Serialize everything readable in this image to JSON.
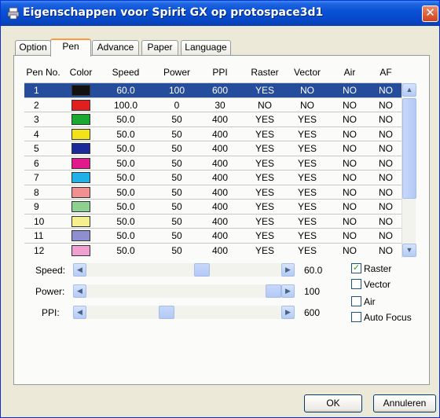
{
  "window": {
    "title": "Eigenschappen voor Spirit GX op protospace3d1",
    "close_glyph": "✕"
  },
  "tabs": [
    {
      "label": "Option",
      "active": false
    },
    {
      "label": "Pen",
      "active": true
    },
    {
      "label": "Advance",
      "active": false
    },
    {
      "label": "Paper",
      "active": false
    },
    {
      "label": "Language",
      "active": false
    }
  ],
  "table": {
    "headers": [
      "Pen No.",
      "Color",
      "Speed",
      "Power",
      "PPI",
      "Raster",
      "Vector",
      "Air",
      "AF"
    ],
    "rows": [
      {
        "pen": "1",
        "color": "#111111",
        "speed": "60.0",
        "power": "100",
        "ppi": "600",
        "raster": "YES",
        "vector": "NO",
        "air": "NO",
        "af": "NO",
        "selected": true
      },
      {
        "pen": "2",
        "color": "#e02020",
        "speed": "100.0",
        "power": "0",
        "ppi": "30",
        "raster": "NO",
        "vector": "NO",
        "air": "NO",
        "af": "NO",
        "selected": false
      },
      {
        "pen": "3",
        "color": "#1aa830",
        "speed": "50.0",
        "power": "50",
        "ppi": "400",
        "raster": "YES",
        "vector": "YES",
        "air": "NO",
        "af": "NO",
        "selected": false
      },
      {
        "pen": "4",
        "color": "#f2e21a",
        "speed": "50.0",
        "power": "50",
        "ppi": "400",
        "raster": "YES",
        "vector": "YES",
        "air": "NO",
        "af": "NO",
        "selected": false
      },
      {
        "pen": "5",
        "color": "#1a2a9a",
        "speed": "50.0",
        "power": "50",
        "ppi": "400",
        "raster": "YES",
        "vector": "YES",
        "air": "NO",
        "af": "NO",
        "selected": false
      },
      {
        "pen": "6",
        "color": "#e01a8a",
        "speed": "50.0",
        "power": "50",
        "ppi": "400",
        "raster": "YES",
        "vector": "YES",
        "air": "NO",
        "af": "NO",
        "selected": false
      },
      {
        "pen": "7",
        "color": "#22b0e8",
        "speed": "50.0",
        "power": "50",
        "ppi": "400",
        "raster": "YES",
        "vector": "YES",
        "air": "NO",
        "af": "NO",
        "selected": false
      },
      {
        "pen": "8",
        "color": "#f09090",
        "speed": "50.0",
        "power": "50",
        "ppi": "400",
        "raster": "YES",
        "vector": "YES",
        "air": "NO",
        "af": "NO",
        "selected": false
      },
      {
        "pen": "9",
        "color": "#8ed090",
        "speed": "50.0",
        "power": "50",
        "ppi": "400",
        "raster": "YES",
        "vector": "YES",
        "air": "NO",
        "af": "NO",
        "selected": false
      },
      {
        "pen": "10",
        "color": "#f5ef90",
        "speed": "50.0",
        "power": "50",
        "ppi": "400",
        "raster": "YES",
        "vector": "YES",
        "air": "NO",
        "af": "NO",
        "selected": false
      },
      {
        "pen": "11",
        "color": "#8e8ed0",
        "speed": "50.0",
        "power": "50",
        "ppi": "400",
        "raster": "YES",
        "vector": "YES",
        "air": "NO",
        "af": "NO",
        "selected": false
      },
      {
        "pen": "12",
        "color": "#f0a0d0",
        "speed": "50.0",
        "power": "50",
        "ppi": "400",
        "raster": "YES",
        "vector": "YES",
        "air": "NO",
        "af": "NO",
        "selected": false
      }
    ]
  },
  "scrollbar": {
    "up_glyph": "▲",
    "down_glyph": "▼",
    "left_glyph": "◀",
    "right_glyph": "▶"
  },
  "sliders": [
    {
      "label": "Speed:",
      "value": "60.0",
      "fraction": 0.6
    },
    {
      "label": "Power:",
      "value": "100",
      "fraction": 1.0
    },
    {
      "label": "PPI:",
      "value": "600",
      "fraction": 0.4
    }
  ],
  "checkboxes": [
    {
      "label": "Raster",
      "checked": true
    },
    {
      "label": "Vector",
      "checked": false
    },
    {
      "label": "Air",
      "checked": false
    },
    {
      "label": "Auto Focus",
      "checked": false
    }
  ],
  "buttons": {
    "ok": "OK",
    "cancel": "Annuleren"
  },
  "colors": {
    "selection": "#264c9c",
    "titlebar": "#0a52d6"
  }
}
